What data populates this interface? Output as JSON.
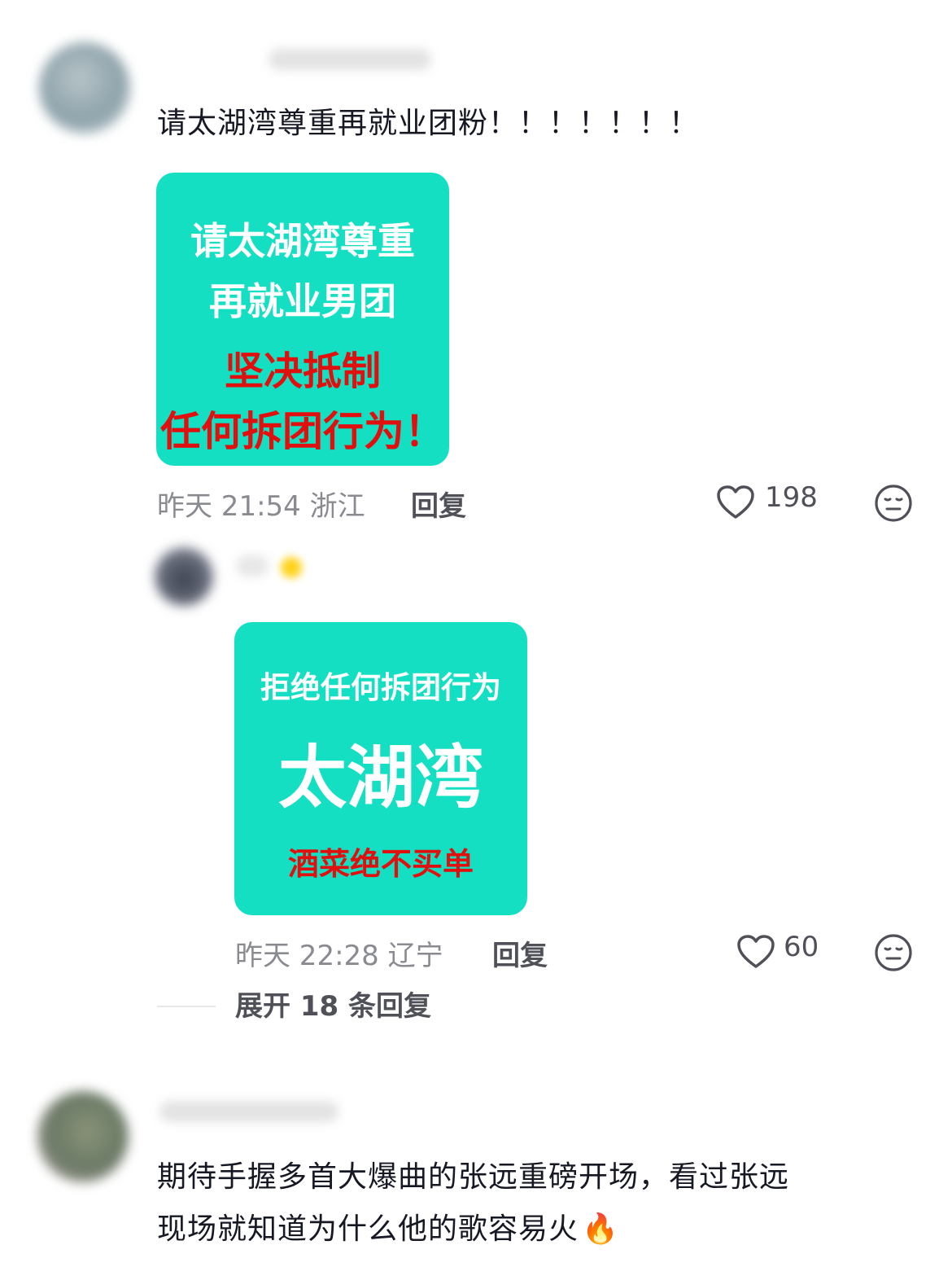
{
  "comments": [
    {
      "text": "请太湖湾尊重再就业团粉！！！！！！！",
      "image_card": {
        "line1": "请太湖湾尊重",
        "line2": "再就业男团",
        "line3": "坚决抵制",
        "line4": "任何拆团行为！",
        "bg": "#14dfc2"
      },
      "time": "昨天 21:54 浙江",
      "reply_label": "回复",
      "likes": "198"
    },
    {
      "image_card": {
        "line1": "拒绝任何拆团行为",
        "line2": "太湖湾",
        "line3": "酒菜绝不买单",
        "bg": "#14dfc2"
      },
      "time": "昨天 22:28 辽宁",
      "reply_label": "回复",
      "likes": "60",
      "expand_label": "展开 18 条回复"
    },
    {
      "text_line1": "期待手握多首大爆曲的张远重磅开场，看过张远",
      "text_line2": "现场就知道为什么他的歌容易火",
      "emoji": "🔥"
    }
  ],
  "icons": {
    "like": "heart-outline-icon",
    "react": "face-neutral-icon",
    "fire": "fire-emoji-icon"
  },
  "colors": {
    "card_bg": "#14dfc2",
    "card_red": "#e0100f",
    "meta_gray": "#8a8b91"
  }
}
